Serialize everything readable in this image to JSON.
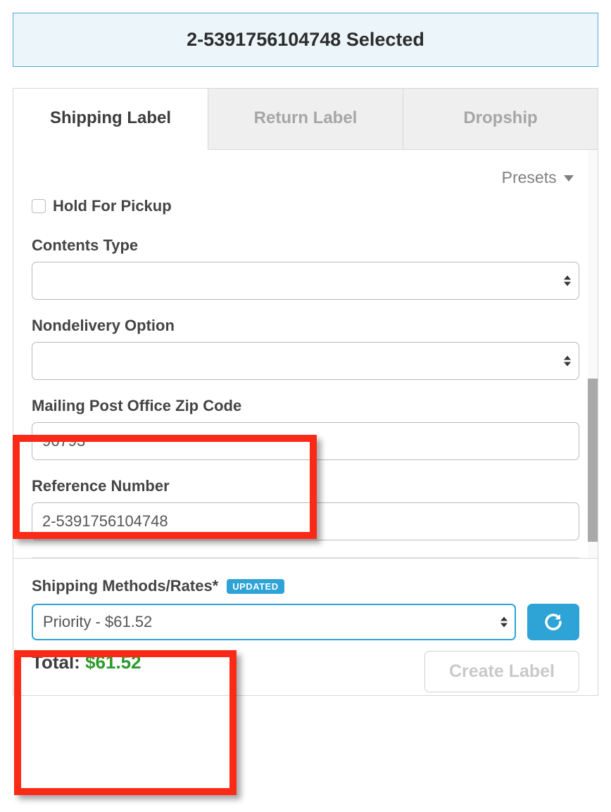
{
  "banner": {
    "text": "2-5391756104748 Selected"
  },
  "tabs": {
    "shipping": "Shipping Label",
    "return": "Return Label",
    "dropship": "Dropship"
  },
  "presets": {
    "label": "Presets"
  },
  "form": {
    "hold_for_pickup_label": "Hold For Pickup",
    "contents_type_label": "Contents Type",
    "contents_type_value": "",
    "nondelivery_label": "Nondelivery Option",
    "nondelivery_value": "",
    "mailing_zip_label": "Mailing Post Office Zip Code",
    "mailing_zip_value": "96793",
    "reference_label": "Reference Number",
    "reference_value": "2-5391756104748"
  },
  "rates": {
    "label": "Shipping Methods/Rates*",
    "badge": "UPDATED",
    "selected": "Priority - $61.52",
    "total_label": "Total: ",
    "total_amount": "$61.52",
    "create_label": "Create Label"
  }
}
